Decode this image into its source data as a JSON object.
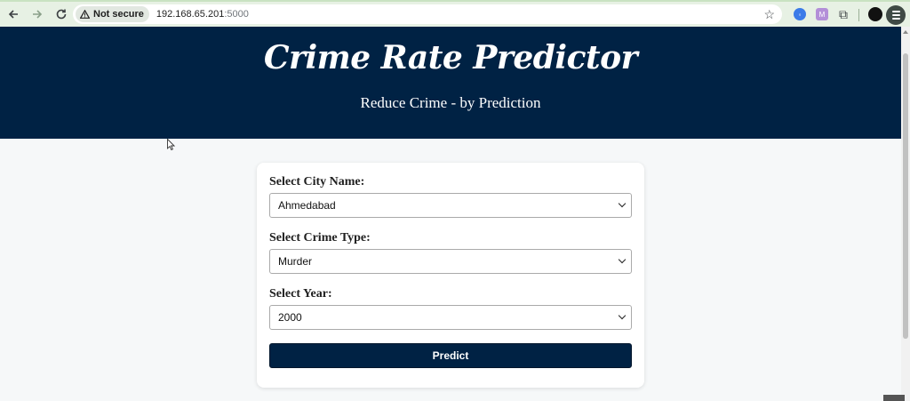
{
  "browser": {
    "security_label": "Not secure",
    "url_host": "192.168.65.201",
    "url_port": ":5000",
    "icons": [
      "back-arrow-icon",
      "forward-arrow-icon",
      "reload-icon",
      "warning-icon",
      "star-icon",
      "extension-icon",
      "puzzle-icon",
      "menu-icon"
    ]
  },
  "hero": {
    "title": "Crime Rate Predictor",
    "subtitle": "Reduce Crime - by Prediction"
  },
  "form": {
    "city_label": "Select City Name:",
    "city_value": "Ahmedabad",
    "crime_label": "Select Crime Type:",
    "crime_value": "Murder",
    "year_label": "Select Year:",
    "year_value": "2000",
    "submit_label": "Predict"
  },
  "colors": {
    "brand": "#002244",
    "page_bg": "#f6f8f9",
    "chrome_bg": "#e7f1e4"
  }
}
